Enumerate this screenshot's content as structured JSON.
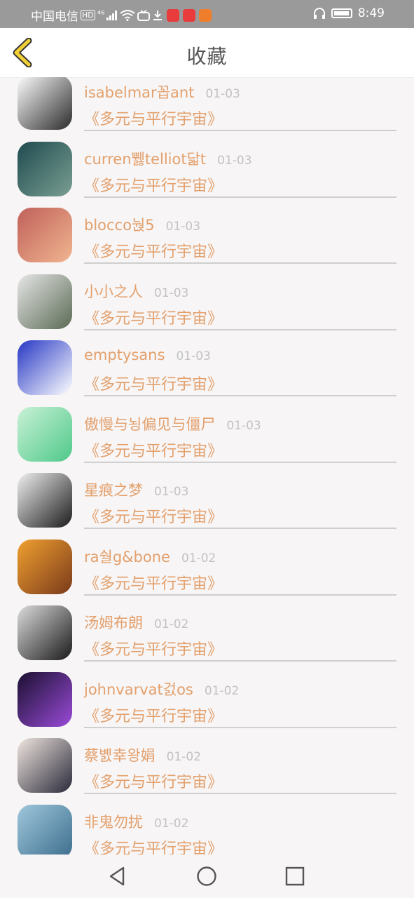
{
  "status_bar": {
    "carrier": "中国电信",
    "network": "HD",
    "signal_label": "⁴⁶",
    "time": "8:49",
    "app_icon_colors": [
      "#e83b3b",
      "#e83b3b",
      "#ef7d2b"
    ]
  },
  "header": {
    "title": "收藏"
  },
  "colors": {
    "accent": "#e3a06c",
    "back_icon": "#f0cf36"
  },
  "favorites": [
    {
      "name": "isabelmar꼽ant",
      "date": "01-03",
      "book": "《多元与平行宇宙》",
      "avatar_colors": [
        "#ffffff",
        "#2b2b2b"
      ]
    },
    {
      "name": "curren쀓telliot닯t",
      "date": "01-03",
      "book": "《多元与平行宇宙》",
      "avatar_colors": [
        "#1f4a4f",
        "#7a9f92"
      ]
    },
    {
      "name": "blocco눥5",
      "date": "01-03",
      "book": "《多元与平行宇宙》",
      "avatar_colors": [
        "#c0605a",
        "#f0b590"
      ]
    },
    {
      "name": "小小之人",
      "date": "01-03",
      "book": "《多元与平行宇宙》",
      "avatar_colors": [
        "#e6e6e6",
        "#5b6a55"
      ]
    },
    {
      "name": "emptysans",
      "date": "01-03",
      "book": "《多元与平行宇宙》",
      "avatar_colors": [
        "#2536c4",
        "#ffffff"
      ]
    },
    {
      "name": "傲慢与뇡偏见与僵尸",
      "date": "01-03",
      "book": "《多元与平行宇宙》",
      "avatar_colors": [
        "#c9f1d6",
        "#4fc98a"
      ]
    },
    {
      "name": "星痕之梦",
      "date": "01-03",
      "book": "《多元与平行宇宙》",
      "avatar_colors": [
        "#f0f0f0",
        "#1c1c1c"
      ]
    },
    {
      "name": "ra숼g&bone",
      "date": "01-02",
      "book": "《多元与平行宇宙》",
      "avatar_colors": [
        "#f0a030",
        "#7a3a1a"
      ]
    },
    {
      "name": "汤姆布朗",
      "date": "01-02",
      "book": "《多元与平行宇宙》",
      "avatar_colors": [
        "#dcdcdc",
        "#1a1a1a"
      ]
    },
    {
      "name": "johnvarvat걼os",
      "date": "01-02",
      "book": "《多元与平行宇宙》",
      "avatar_colors": [
        "#1a1030",
        "#9a4bd8"
      ]
    },
    {
      "name": "蔡볤幸왕娟",
      "date": "01-02",
      "book": "《多元与平行宇宙》",
      "avatar_colors": [
        "#f0e6e0",
        "#2a2a3a"
      ]
    },
    {
      "name": "非鬼勿扰",
      "date": "01-02",
      "book": "《多元与平行宇宙》",
      "avatar_colors": [
        "#9fc7dc",
        "#3c6d8c"
      ]
    }
  ]
}
